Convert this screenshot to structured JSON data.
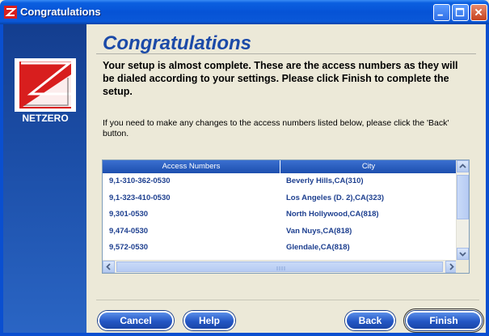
{
  "window": {
    "title": "Congratulations",
    "icon": "netzero-z-icon"
  },
  "sidebar": {
    "logo_text": "NETZERO"
  },
  "main": {
    "heading": "Congratulations",
    "intro": "Your setup is almost complete. These are the access numbers as they will be dialed according to your settings. Please click Finish to complete the setup.",
    "note": "If you need to make any changes to the access numbers listed below, please click the 'Back' button."
  },
  "list": {
    "columns": [
      "Access Numbers",
      "City"
    ],
    "rows": [
      {
        "number": "9,1-310-362-0530",
        "city": "Beverly Hills,CA(310)"
      },
      {
        "number": "9,1-323-410-0530",
        "city": "Los Angeles (D. 2),CA(323)"
      },
      {
        "number": "9,301-0530",
        "city": "North Hollywood,CA(818)"
      },
      {
        "number": "9,474-0530",
        "city": "Van Nuys,CA(818)"
      },
      {
        "number": "9,572-0530",
        "city": "Glendale,CA(818)"
      }
    ]
  },
  "buttons": {
    "cancel": "Cancel",
    "help": "Help",
    "back": "Back",
    "finish": "Finish"
  },
  "colors": {
    "titlebar": "#0653d6",
    "heading": "#1b4aa8",
    "list_text": "#1d3f8f",
    "button": "#2456c4"
  }
}
